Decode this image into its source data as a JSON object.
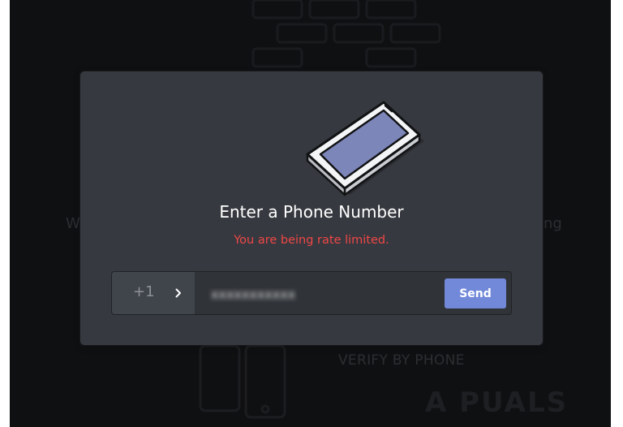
{
  "modal": {
    "title": "Enter a Phone Number",
    "error_message": "You are being rate limited.",
    "country_code": "+1",
    "phone_value": "xxxxxxxxxxx",
    "send_label": "Send"
  },
  "background": {
    "left_fragment": "W",
    "right_fragment": "ng",
    "verify_label": "VERIFY BY PHONE",
    "watermark": "A PUALS"
  },
  "icons": {
    "illustration": "phone-illustration-icon",
    "chevron": "chevron-right-icon"
  },
  "colors": {
    "modal_bg": "#36393f",
    "error": "#f04747",
    "accent": "#7289da",
    "backdrop": "#0f1012"
  }
}
